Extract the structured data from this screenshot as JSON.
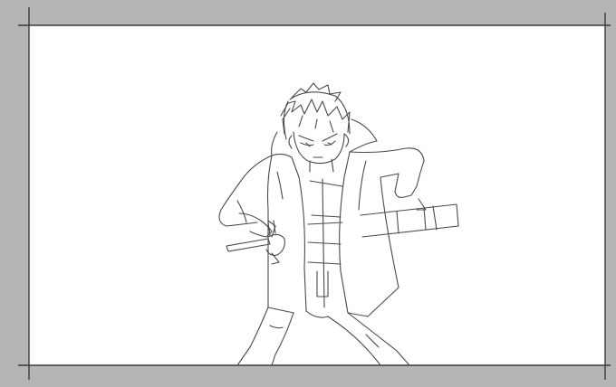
{
  "canvas": {
    "background_color": "#b5b5b5",
    "paper_color": "#ffffff",
    "line_color": "#4a4a4a",
    "frame_line_color": "#3a3a3a"
  },
  "artwork": {
    "subject": "anime-character-line-art",
    "elements": [
      "spiky-hair",
      "scowling-face",
      "open-jacket",
      "sword-hilt",
      "scabbard",
      "stance-legs"
    ]
  }
}
